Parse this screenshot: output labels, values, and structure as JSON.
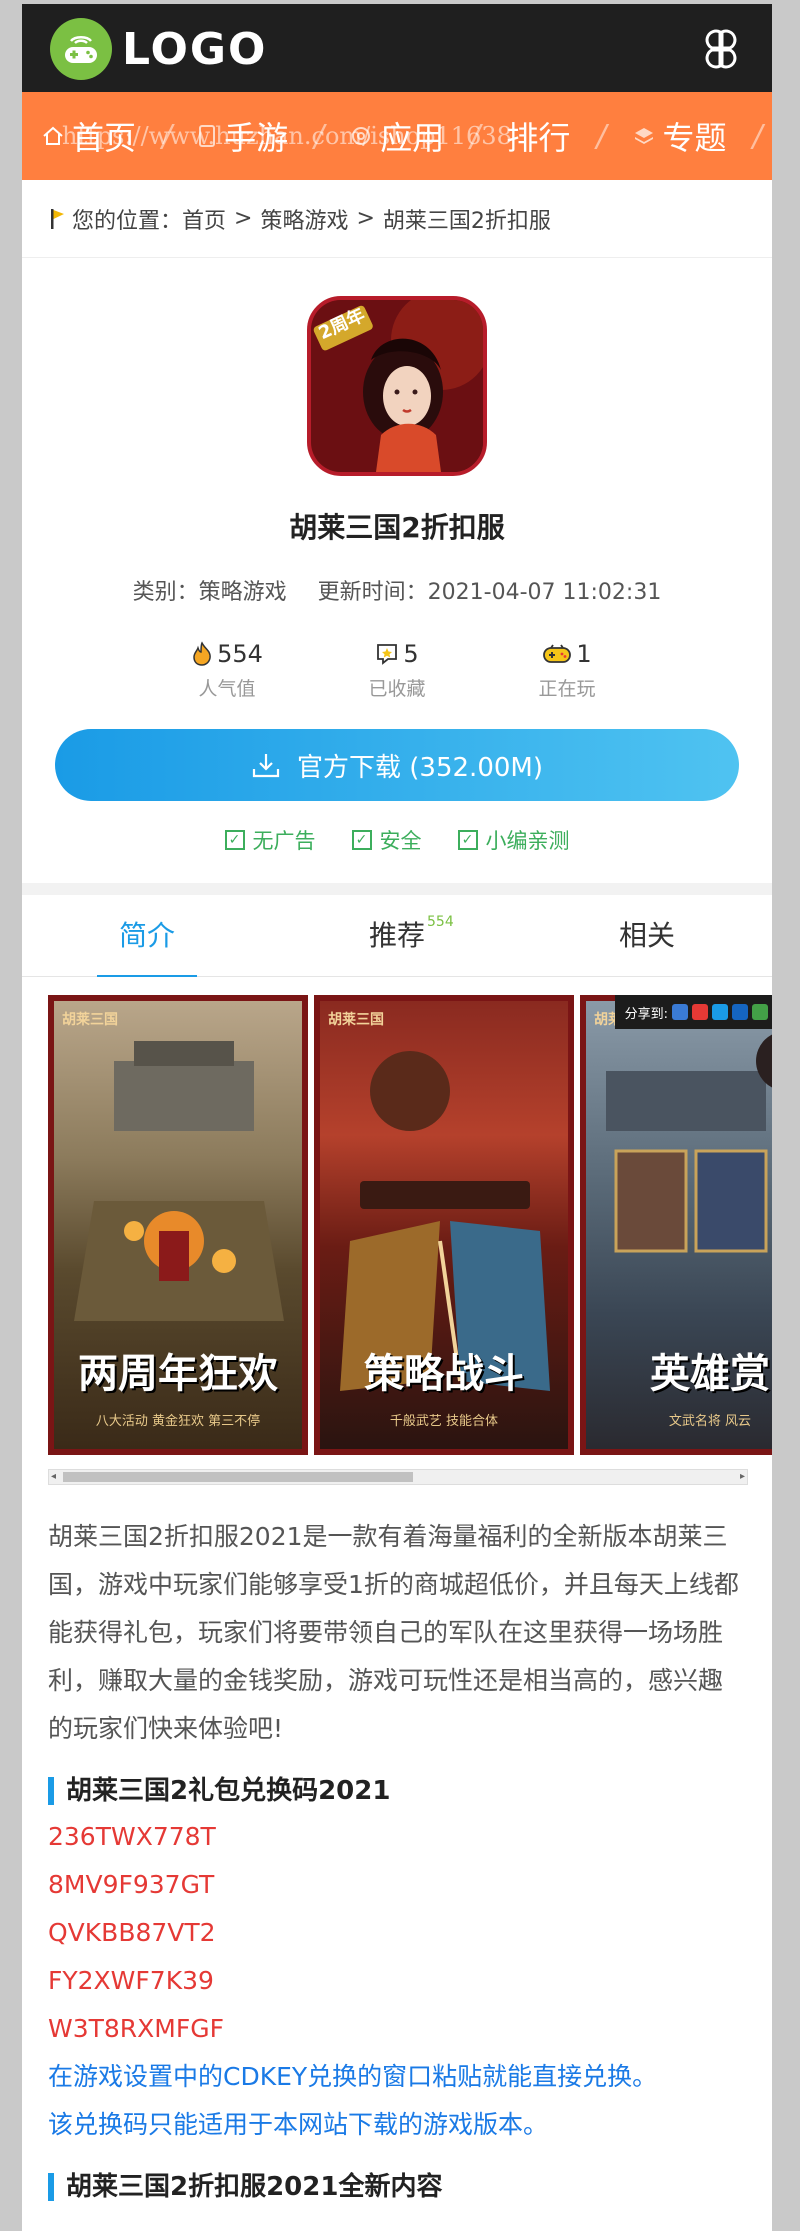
{
  "header": {
    "logo_text": "LOGO"
  },
  "nav": {
    "items": [
      {
        "label": "首页",
        "icon": "home-icon"
      },
      {
        "label": "手游",
        "icon": "phone-icon"
      },
      {
        "label": "应用",
        "icon": "app-icon"
      },
      {
        "label": "排行",
        "icon": ""
      },
      {
        "label": "专题",
        "icon": "topic-icon"
      }
    ],
    "watermark": "https://www.huzhan.com/ishop11638"
  },
  "breadcrumb": {
    "prefix": "您的位置：",
    "items": [
      "首页",
      "策略游戏",
      "胡莱三国2折扣服"
    ],
    "separator": ">"
  },
  "app": {
    "icon_badge": "2周年",
    "name": "胡莱三国2折扣服",
    "category": "类别：策略游戏",
    "updated": "更新时间：2021-04-07 11:02:31",
    "stats": [
      {
        "value": "554",
        "label": "人气值",
        "icon": "fire-icon"
      },
      {
        "value": "5",
        "label": "已收藏",
        "icon": "star-icon"
      },
      {
        "value": "1",
        "label": "正在玩",
        "icon": "gamepad-icon"
      }
    ],
    "download_label": "官方下载 (352.00M)",
    "badges": [
      "无广告",
      "安全",
      "小编亲测"
    ]
  },
  "tabs": [
    {
      "label": "简介",
      "active": true,
      "count": ""
    },
    {
      "label": "推荐",
      "active": false,
      "count": "554"
    },
    {
      "label": "相关",
      "active": false,
      "count": ""
    }
  ],
  "screenshots": [
    {
      "tag": "胡莱三国",
      "caption": "两周年狂欢",
      "sub": "八大活动 黄金狂欢 第三不停"
    },
    {
      "tag": "胡莱三国",
      "caption": "策略战斗",
      "sub": "千般武艺 技能合体"
    },
    {
      "tag": "胡莱三国",
      "caption": "英雄赏",
      "sub": "文武名将 风云"
    }
  ],
  "share": {
    "label": "分享到:"
  },
  "article": {
    "intro": "胡莱三国2折扣服2021是一款有着海量福利的全新版本胡莱三国，游戏中玩家们能够享受1折的商城超低价，并且每天上线都能获得礼包，玩家们将要带领自己的军队在这里获得一场场胜利，赚取大量的金钱奖励，游戏可玩性还是相当高的，感兴趣的玩家们快来体验吧!",
    "codes_title": "胡莱三国2礼包兑换码2021",
    "codes": [
      "236TWX778T",
      "8MV9F937GT",
      "QVKBB87VT2",
      "FY2XWF7K39",
      "W3T8RXMFGF"
    ],
    "notes": [
      "在游戏设置中的CDKEY兑换的窗口粘贴就能直接兑换。",
      "该兑换码只能适用于本网站下载的游戏版本。"
    ],
    "section2_title": "胡莱三国2折扣服2021全新内容"
  },
  "colors": {
    "header_bg": "#1f1f1f",
    "nav_bg": "#ff7f3f",
    "accent": "#1a9be6",
    "code_red": "#e53935",
    "note_blue": "#1a7ae6"
  }
}
